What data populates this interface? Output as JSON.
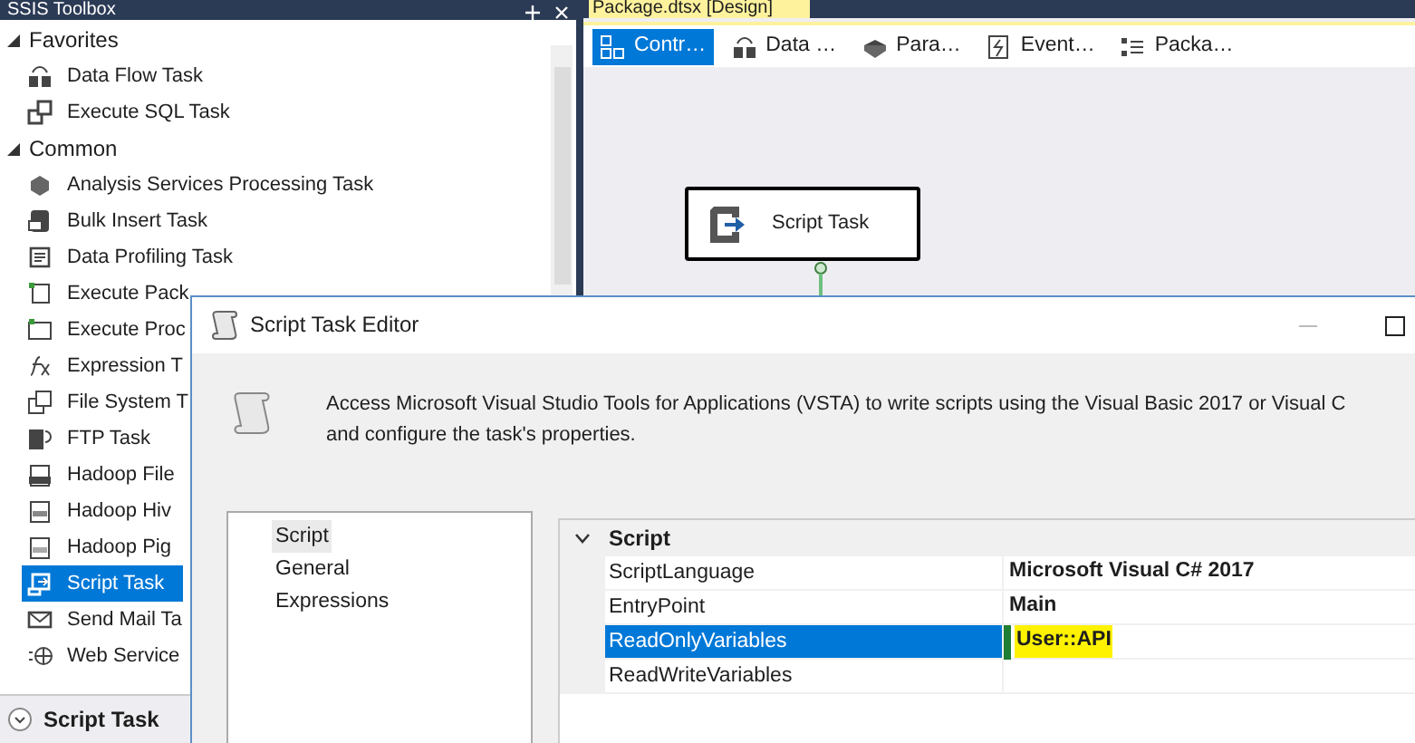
{
  "toolbox": {
    "title": "SSIS Toolbox",
    "groups": [
      {
        "label": "Favorites",
        "expanded": true,
        "children": [
          {
            "label": "Data Flow Task",
            "selected": false
          },
          {
            "label": "Execute SQL Task",
            "selected": false
          }
        ]
      },
      {
        "label": "Common",
        "expanded": true,
        "children": [
          {
            "label": "Analysis Services Processing Task",
            "selected": false
          },
          {
            "label": "Bulk Insert Task",
            "selected": false
          },
          {
            "label": "Data Profiling Task",
            "selected": false
          },
          {
            "label": "Execute Pack",
            "selected": false
          },
          {
            "label": "Execute Proc",
            "selected": false
          },
          {
            "label": "Expression T",
            "selected": false
          },
          {
            "label": "File System T",
            "selected": false
          },
          {
            "label": "FTP Task",
            "selected": false
          },
          {
            "label": "Hadoop File",
            "selected": false
          },
          {
            "label": "Hadoop Hiv",
            "selected": false
          },
          {
            "label": "Hadoop Pig",
            "selected": false
          },
          {
            "label": "Script Task",
            "selected": true
          },
          {
            "label": "Send Mail Ta",
            "selected": false
          },
          {
            "label": "Web Service",
            "selected": false
          }
        ]
      }
    ],
    "footer": {
      "label": "Script Task"
    }
  },
  "designer": {
    "document_tab": "Package.dtsx [Design]",
    "tabs": [
      {
        "label": "Contr…",
        "selected": true
      },
      {
        "label": "Data …",
        "selected": false
      },
      {
        "label": "Para…",
        "selected": false
      },
      {
        "label": "Event…",
        "selected": false
      },
      {
        "label": "Packa…",
        "selected": false
      }
    ],
    "node": {
      "label": "Script Task"
    }
  },
  "dialog": {
    "title": "Script Task Editor",
    "description": [
      "Access Microsoft Visual Studio Tools for Applications (VSTA) to write scripts using the Visual Basic 2017 or Visual C",
      "and configure the task's properties."
    ],
    "nav": [
      {
        "label": "Script",
        "selected": true
      },
      {
        "label": "General",
        "selected": false
      },
      {
        "label": "Expressions",
        "selected": false
      }
    ],
    "grid": {
      "category": {
        "label": "Script",
        "expanded": true
      },
      "rows": [
        {
          "name": "ScriptLanguage",
          "value": "Microsoft Visual C# 2017",
          "selected": false
        },
        {
          "name": "EntryPoint",
          "value": "Main",
          "selected": false
        },
        {
          "name": "ReadOnlyVariables",
          "value": "User::API",
          "selected": true
        },
        {
          "name": "ReadWriteVariables",
          "selected": false
        }
      ]
    }
  }
}
